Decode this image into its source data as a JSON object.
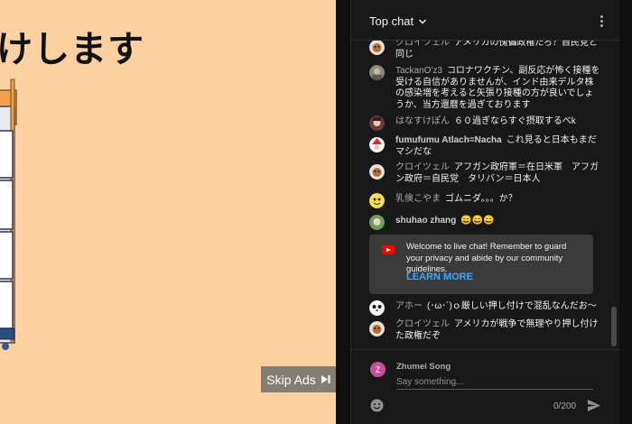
{
  "video": {
    "title_fragment": "けします",
    "skip_label": "Skip Ads"
  },
  "chat": {
    "title": "Top chat",
    "messages": [
      {
        "author": "クロイツェル",
        "author_bold": false,
        "text": "アメリカの傀儡政権だろ？自民党と同じ",
        "avatar": "fox-avatar"
      },
      {
        "author": "TackanO'z3",
        "author_bold": false,
        "text": "コロナワクチン、副反応が怖く接種を受ける自信がありませんが、インド由来デルタ株の感染増を考えると矢張り接種の方が良いでしょうか、当方還暦を過ぎております",
        "avatar": "photo-avatar"
      },
      {
        "author": "はなすけぽん",
        "author_bold": false,
        "text": "６０過ぎならすぐ摂取するべk",
        "avatar": "character-avatar"
      },
      {
        "author": "fumufumu Atlach=Nacha",
        "author_bold": true,
        "text": "これ見ると日本もまだマシだな",
        "avatar": "santa-avatar"
      },
      {
        "author": "クロイツェル",
        "author_bold": false,
        "text": "アフガン政府軍＝在日米軍　アフガン政府＝自民党　タリバン＝日本人",
        "avatar": "fox-avatar"
      },
      {
        "author": "乳倹こやま",
        "author_bold": false,
        "text": "ゴムニダ。。。か？",
        "avatar": "yellow-avatar"
      },
      {
        "author": "shuhao zhang",
        "author_bold": true,
        "text": "😄😄😄",
        "avatar": "green-avatar"
      },
      {
        "author": "アホー",
        "author_bold": false,
        "text": "(･ω･´)ｏ厳しい押し付けで混乱なんだお〜",
        "avatar": "panda-avatar"
      },
      {
        "author": "クロイツェル",
        "author_bold": false,
        "text": "アメリカが戦争で無理やり押し付けた政権だぞ",
        "avatar": "fox-avatar"
      }
    ],
    "welcome": {
      "text": "Welcome to live chat! Remember to guard your privacy and abide by our community guidelines.",
      "link": "LEARN MORE"
    },
    "composer": {
      "user_initial": "Z",
      "user_name": "Zhumei Song",
      "placeholder": "Say something...",
      "char_count": "0/200"
    }
  },
  "colors": {
    "video_bg": "#fdd1a1",
    "chat_bg": "#181818",
    "link": "#3ea6ff",
    "youtube_red": "#ff0000"
  }
}
